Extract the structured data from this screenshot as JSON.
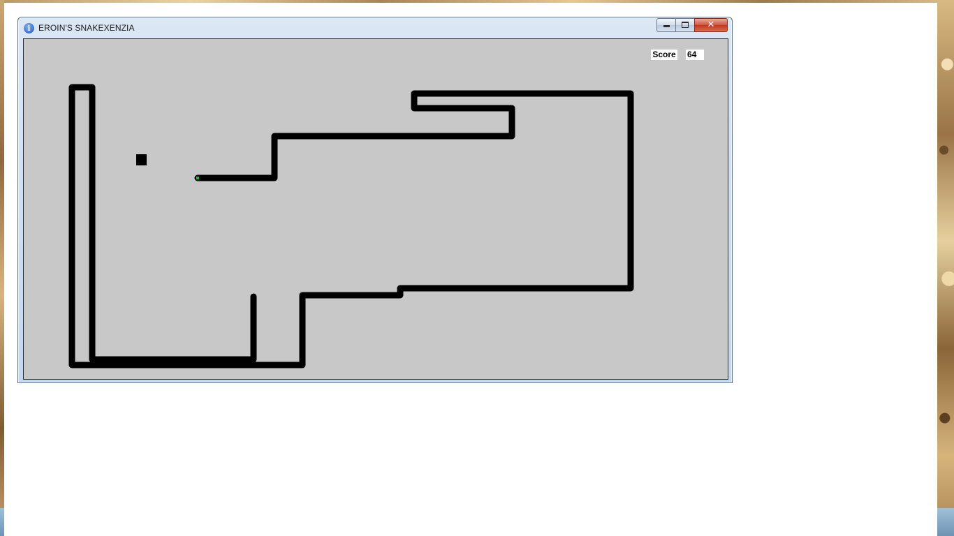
{
  "window": {
    "title": "EROIN'S SNAKEXENZIA",
    "icon": "info-icon",
    "controls": {
      "minimize": "minimize-icon",
      "maximize": "maximize-icon",
      "close": "close-icon"
    }
  },
  "game": {
    "score_label": "Score",
    "score_value": "64",
    "colors": {
      "board": "#c8c8c8",
      "snake": "#000000",
      "food": "#000000",
      "head_dot": "#20c020"
    }
  }
}
